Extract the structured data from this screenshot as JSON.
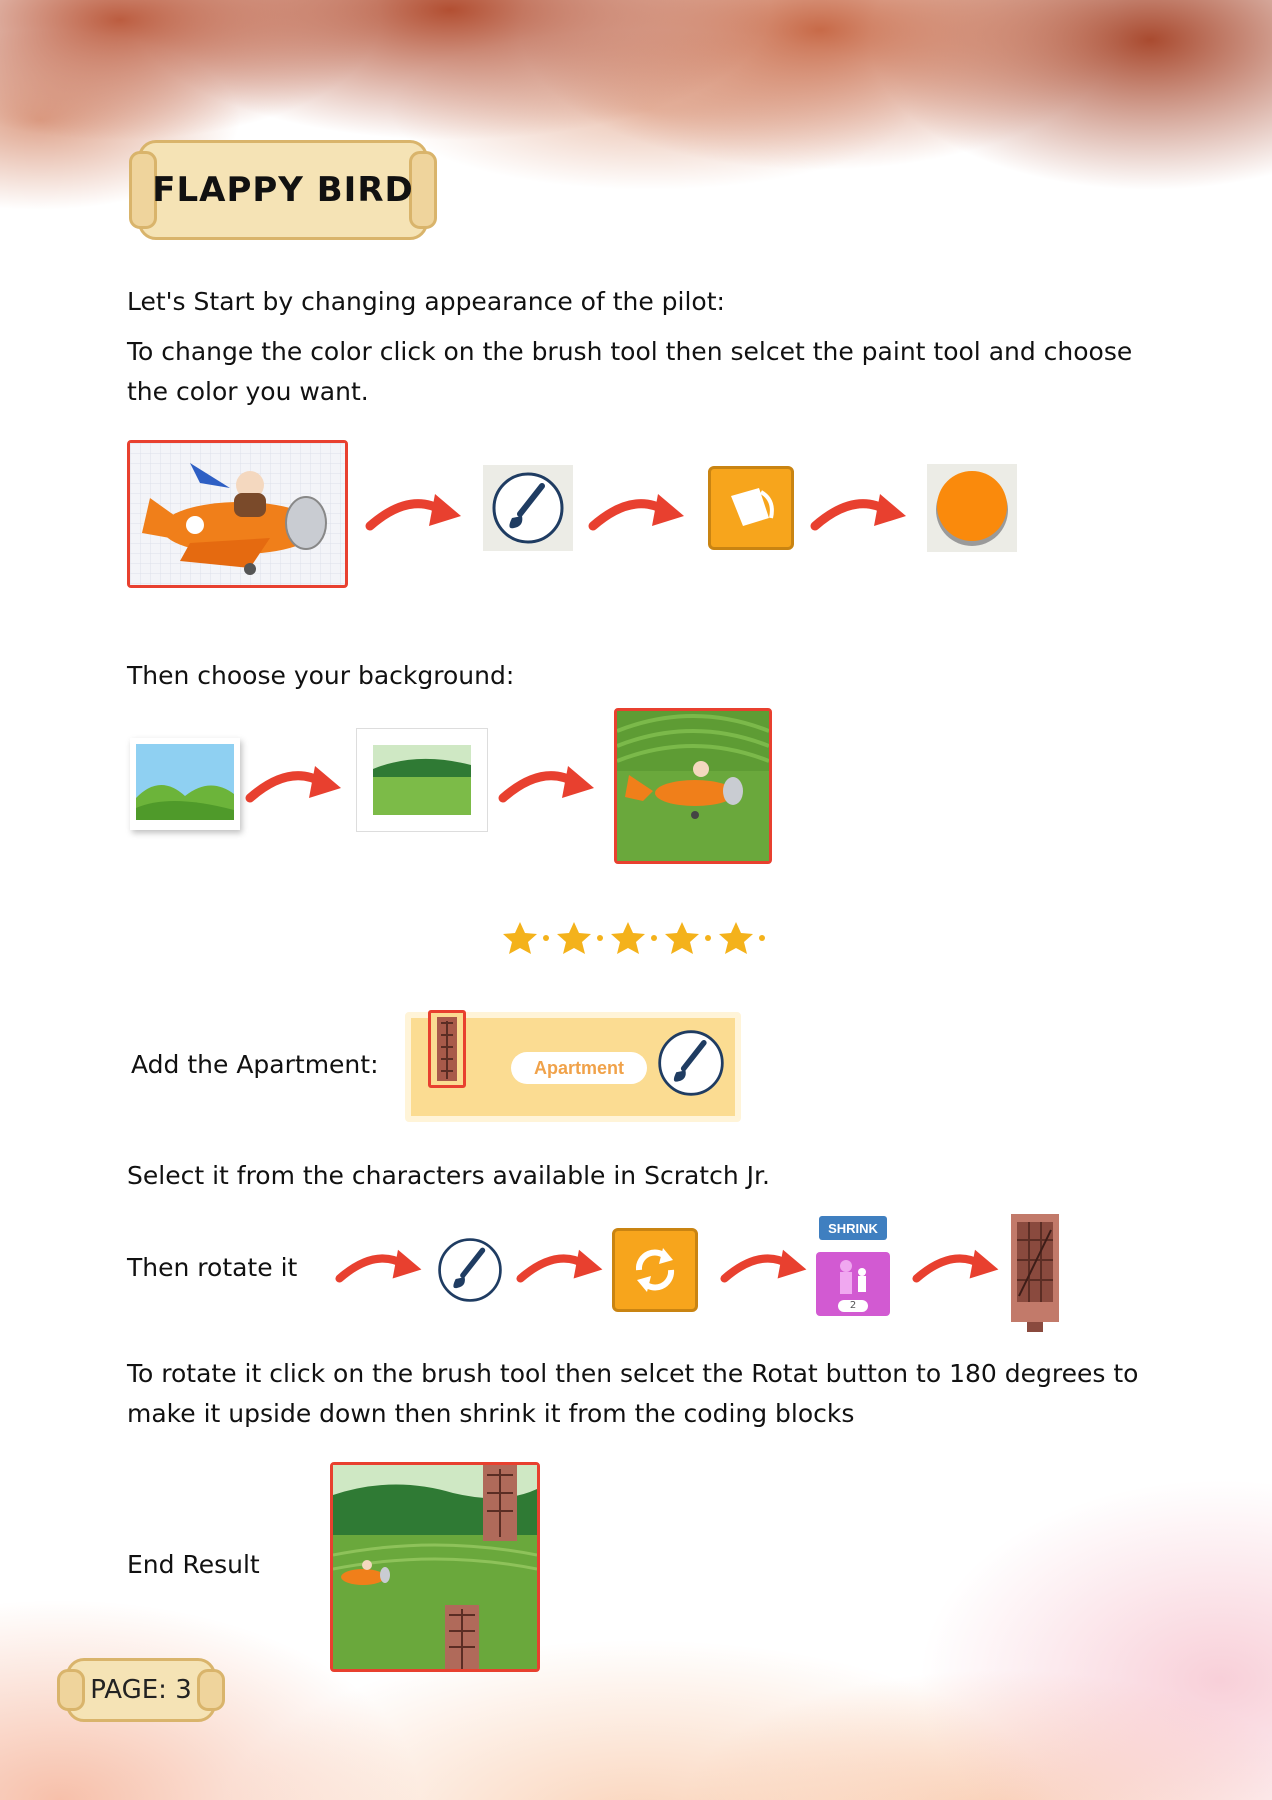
{
  "title": "FLAPPY BIRD",
  "intro": "Let's Start by changing appearance of the pilot:",
  "color_instruction": "To change the color click on the  brush tool then selcet the paint tool and choose the color you want.",
  "background_instruction": "Then choose your background:",
  "add_apartment": "Add the Apartment:",
  "apartment_label": "Apartment",
  "select_instruction": "Select it from the characters available in Scratch Jr.",
  "rotate_label": "Then rotate it",
  "shrink_label": "SHRINK",
  "shrink_value": "2",
  "rotate_instruction": "To rotate it  click on the brush tool then selcet the Rotat button to 180 degrees to make it upside down then shrink it from the coding blocks",
  "end_result": "End Result",
  "page_label": "PAGE: 3",
  "colors": {
    "accent_red": "#e8402f",
    "paint_orange": "#f7a51c",
    "plane_orange": "#f07f1a",
    "shrink_pink": "#d25ad2",
    "star_yellow": "#f4b21b",
    "grass_green": "#6aa83c"
  }
}
